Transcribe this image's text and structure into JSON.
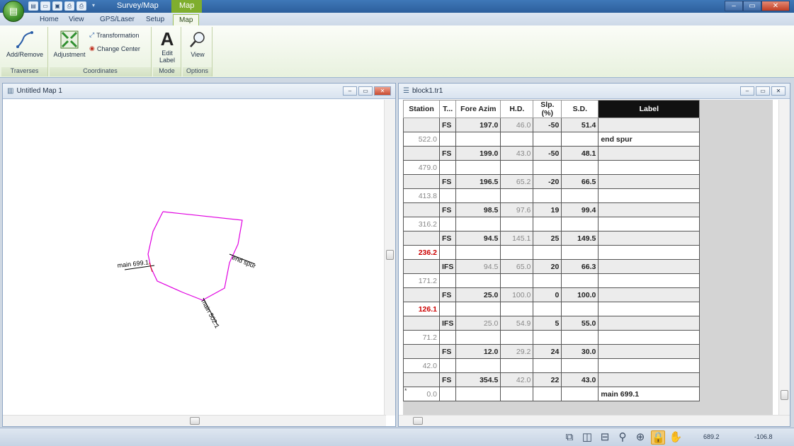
{
  "titlebar": {
    "app_tab": "Survey/Map",
    "context_tab": "Map"
  },
  "tabs": [
    "Home",
    "View",
    "GPS/Laser",
    "Setup",
    "Map"
  ],
  "ribbon": {
    "traverses": {
      "label": "Traverses",
      "add_remove": "Add/Remove"
    },
    "coordinates": {
      "label": "Coordinates",
      "adjustment": "Adjustment",
      "transformation": "Transformation",
      "change_center": "Change Center"
    },
    "mode": {
      "label": "Mode",
      "edit_label_1": "Edit",
      "edit_label_2": "Label"
    },
    "options": {
      "label": "Options",
      "view": "View"
    }
  },
  "map_window": {
    "title": "Untitled Map 1",
    "labels": {
      "main_start": "main 699.1",
      "end_spur": "end spur",
      "main_mid": "main 502.1"
    }
  },
  "grid_window": {
    "title": "block1.tr1",
    "columns": [
      "Station",
      "T...",
      "Fore Azim",
      "H.D.",
      "Slp.(%)",
      "S.D.",
      "Label"
    ],
    "rows": [
      {
        "station": "",
        "type": "FS",
        "azim": "197.0",
        "hd": "46.0",
        "slope": "-50",
        "sd": "51.4",
        "label": ""
      },
      {
        "station": "522.0",
        "type": "",
        "azim": "",
        "hd": "",
        "slope": "",
        "sd": "",
        "label": "end spur"
      },
      {
        "station": "",
        "type": "FS",
        "azim": "199.0",
        "hd": "43.0",
        "slope": "-50",
        "sd": "48.1",
        "label": ""
      },
      {
        "station": "479.0",
        "type": "",
        "azim": "",
        "hd": "",
        "slope": "",
        "sd": "",
        "label": ""
      },
      {
        "station": "",
        "type": "FS",
        "azim": "196.5",
        "hd": "65.2",
        "slope": "-20",
        "sd": "66.5",
        "label": ""
      },
      {
        "station": "413.8",
        "type": "",
        "azim": "",
        "hd": "",
        "slope": "",
        "sd": "",
        "label": ""
      },
      {
        "station": "",
        "type": "FS",
        "azim": "98.5",
        "hd": "97.6",
        "slope": "19",
        "sd": "99.4",
        "label": ""
      },
      {
        "station": "316.2",
        "type": "",
        "azim": "",
        "hd": "",
        "slope": "",
        "sd": "",
        "label": ""
      },
      {
        "station": "",
        "type": "FS",
        "azim": "94.5",
        "hd": "145.1",
        "slope": "25",
        "sd": "149.5",
        "label": ""
      },
      {
        "station": "236.2",
        "type": "",
        "azim": "",
        "hd": "",
        "slope": "",
        "sd": "",
        "label": "",
        "red": true
      },
      {
        "station": "",
        "type": "IFS",
        "azim": "94.5",
        "hd": "65.0",
        "slope": "20",
        "sd": "66.3",
        "label": "",
        "grey_azim": true
      },
      {
        "station": "171.2",
        "type": "",
        "azim": "",
        "hd": "",
        "slope": "",
        "sd": "",
        "label": ""
      },
      {
        "station": "",
        "type": "FS",
        "azim": "25.0",
        "hd": "100.0",
        "slope": "0",
        "sd": "100.0",
        "label": ""
      },
      {
        "station": "126.1",
        "type": "",
        "azim": "",
        "hd": "",
        "slope": "",
        "sd": "",
        "label": "",
        "red": true
      },
      {
        "station": "",
        "type": "IFS",
        "azim": "25.0",
        "hd": "54.9",
        "slope": "5",
        "sd": "55.0",
        "label": "",
        "grey_azim": true
      },
      {
        "station": "71.2",
        "type": "",
        "azim": "",
        "hd": "",
        "slope": "",
        "sd": "",
        "label": ""
      },
      {
        "station": "",
        "type": "FS",
        "azim": "12.0",
        "hd": "29.2",
        "slope": "24",
        "sd": "30.0",
        "label": ""
      },
      {
        "station": "42.0",
        "type": "",
        "azim": "",
        "hd": "",
        "slope": "",
        "sd": "",
        "label": ""
      },
      {
        "station": "",
        "type": "FS",
        "azim": "354.5",
        "hd": "42.0",
        "slope": "22",
        "sd": "43.0",
        "label": ""
      },
      {
        "station": "0.0",
        "type": "",
        "azim": "",
        "hd": "",
        "slope": "",
        "sd": "",
        "label": "main 699.1",
        "marker": "*"
      }
    ]
  },
  "status": {
    "x": "689.2",
    "y": "-106.8"
  },
  "colors": {
    "traverse_line": "#e000e0",
    "accent_tab": "#7fae2e",
    "red_station": "#cc0000"
  }
}
